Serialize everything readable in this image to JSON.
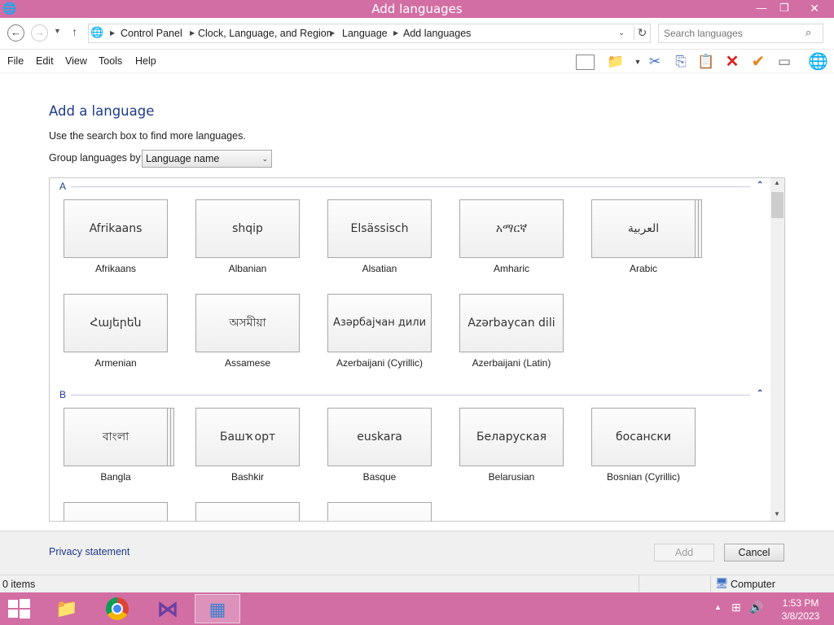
{
  "window": {
    "title": "Add languages"
  },
  "address": {
    "crumbs": [
      "Control Panel",
      "Clock, Language, and Region",
      "Language",
      "Add languages"
    ]
  },
  "search": {
    "placeholder": "Search languages"
  },
  "menu": [
    "File",
    "Edit",
    "View",
    "Tools",
    "Help"
  ],
  "page": {
    "heading": "Add a language",
    "hint": "Use the search box to find more languages.",
    "group_label": "Group languages by:",
    "group_value": "Language name"
  },
  "groups": [
    {
      "letter": "A",
      "languages": [
        {
          "native": "Afrikaans",
          "name": "Afrikaans",
          "stacked": false
        },
        {
          "native": "shqip",
          "name": "Albanian",
          "stacked": false
        },
        {
          "native": "Elsässisch",
          "name": "Alsatian",
          "stacked": false
        },
        {
          "native": "አማርኛ",
          "name": "Amharic",
          "stacked": false
        },
        {
          "native": "العربية",
          "name": "Arabic",
          "stacked": true
        },
        {
          "native": "Հայերեն",
          "name": "Armenian",
          "stacked": false
        },
        {
          "native": "অসমীয়া",
          "name": "Assamese",
          "stacked": false
        },
        {
          "native": "Азәрбајҹан дили",
          "name": "Azerbaijani (Cyrillic)",
          "stacked": false
        },
        {
          "native": "Azərbaycan dili",
          "name": "Azerbaijani (Latin)",
          "stacked": false
        }
      ]
    },
    {
      "letter": "B",
      "languages": [
        {
          "native": "বাংলা",
          "name": "Bangla",
          "stacked": true
        },
        {
          "native": "Башҡорт",
          "name": "Bashkir",
          "stacked": false
        },
        {
          "native": "euskara",
          "name": "Basque",
          "stacked": false
        },
        {
          "native": "Беларуская",
          "name": "Belarusian",
          "stacked": false
        },
        {
          "native": "босански",
          "name": "Bosnian (Cyrillic)",
          "stacked": false
        }
      ]
    }
  ],
  "footer": {
    "privacy": "Privacy statement",
    "add": "Add",
    "cancel": "Cancel"
  },
  "status": {
    "items": "0 items",
    "location": "Computer"
  },
  "clock": {
    "time": "1:53 PM",
    "date": "3/8/2023"
  },
  "colors": {
    "accent": "#d26ea4",
    "link": "#1e3a8c"
  }
}
